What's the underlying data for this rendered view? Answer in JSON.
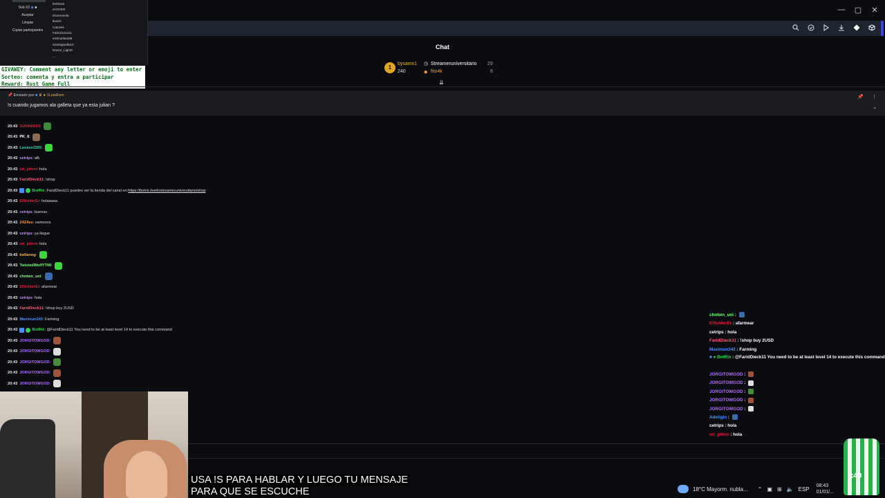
{
  "window": {
    "minimize": "—",
    "maximize": "▢",
    "close": "✕"
  },
  "toolbar_icons": [
    "search-icon",
    "shield-icon",
    "play-icon",
    "download-icon",
    "diamond-icon",
    "cube-icon"
  ],
  "control_panel": {
    "sub_label": "Sub X2",
    "accept": "Aceptar",
    "clear": "Limpiar",
    "copy": "Copiar participantes",
    "participants": [
      "bmbew2",
      "erc0r300",
      "elcomenela",
      "tlautr2",
      "Catozes",
      "Fabrizio11111",
      "emilcarlaso89",
      "Santiagoalfa10",
      "Doctor_LightX",
      "..."
    ]
  },
  "giveaway": {
    "line1": "GIVAWEY: Comment any letter or emoji to enter",
    "line2": "Sorteo: comenta y entra a participar",
    "line3": "Reward: Rust Game Full"
  },
  "chat_header": {
    "title": "Chat",
    "leader_rank": "1",
    "leader1_name": "bysamx1",
    "leader1_points": "240",
    "leader2_name": "Streameruniversitario",
    "leader2_points": "29",
    "leader3_name": "fito4k",
    "leader3_points": "8"
  },
  "pinned": {
    "sent_by": "Enviado por",
    "user": "1LuisRem",
    "message": "!s cuando jugamos ala galleta que ya esta julian ?"
  },
  "messages": [
    {
      "time": "20:43",
      "user": "GIANNIS93",
      "color": "#e0203b",
      "text": "",
      "emote": "#3f8a3a"
    },
    {
      "time": "20:43",
      "user": "PK_6",
      "color": "#ffffff",
      "text": "",
      "emote": "#8a6a52"
    },
    {
      "time": "20:43",
      "user": "Lucass1555",
      "color": "#3fd4b6",
      "text": "",
      "emote": "#3ed63e"
    },
    {
      "time": "20:43",
      "user": "cetrips",
      "color": "#c58bff",
      "text": "afk",
      "emote": ""
    },
    {
      "time": "20:43",
      "user": "uri_pitom",
      "color": "#e0203b",
      "text": "hola",
      "emote": ""
    },
    {
      "time": "20:43",
      "user": "FaridDieck11",
      "color": "#ff5c7a",
      "text": "!shop",
      "emote": ""
    },
    {
      "time": "20:43",
      "user": "BotRix",
      "color": "#35d05a",
      "text": "FaridDieck11 puedes ver la tienda del canal en: ",
      "link": "https://botrix.live/k/streameruniversitario/shop",
      "emote": ""
    },
    {
      "time": "20:43",
      "user": "ElSolderEr",
      "color": "#e0203b",
      "text": "holaaaaa",
      "emote": ""
    },
    {
      "time": "20:43",
      "user": "cetrips",
      "color": "#c58bff",
      "text": "buenas",
      "emote": ""
    },
    {
      "time": "20:43",
      "user": "Z4Z4ss",
      "color": "#ff9a3c",
      "text": "vamooos",
      "emote": ""
    },
    {
      "time": "20:43",
      "user": "cetrips",
      "color": "#c58bff",
      "text": "ya llegue",
      "emote": ""
    },
    {
      "time": "20:43",
      "user": "uri_pitom",
      "color": "#e0203b",
      "text": "hola",
      "emote": ""
    },
    {
      "time": "20:43",
      "user": "bollanog",
      "color": "#ffb347",
      "text": "",
      "emote": "#3ed63e"
    },
    {
      "time": "20:43",
      "user": "TwistedWolfYT00",
      "color": "#7dff7d",
      "text": "",
      "emote": "#3ed63e"
    },
    {
      "time": "20:43",
      "user": "chntwn_uni",
      "color": "#7dff7d",
      "text": "",
      "emote": "#3a6bb0"
    },
    {
      "time": "20:43",
      "user": "ElSolderEr",
      "color": "#e0203b",
      "text": "afarmear",
      "emote": ""
    },
    {
      "time": "20:43",
      "user": "cetrips",
      "color": "#c58bff",
      "text": "hola",
      "emote": ""
    },
    {
      "time": "20:43",
      "user": "FaridDieck11",
      "color": "#ff5c7a",
      "text": "!shop buy 2USD",
      "emote": ""
    },
    {
      "time": "20:43",
      "user": "Maximun342",
      "color": "#4f8dff",
      "text": "Farming",
      "emote": ""
    },
    {
      "time": "20:43",
      "user": "BotRix",
      "color": "#35d05a",
      "text": "@FaridDieck11 You need to be at least level 14 to execute this command",
      "emote": ""
    },
    {
      "time": "20:43",
      "user": "JORGITOWGOD",
      "color": "#b46bff",
      "text": "",
      "emote": "#a0523b"
    },
    {
      "time": "20:43",
      "user": "JORGITOWGOD",
      "color": "#b46bff",
      "text": "",
      "emote": "#dddddd"
    },
    {
      "time": "20:43",
      "user": "JORGITOWGOD",
      "color": "#b46bff",
      "text": "",
      "emote": "#4a8a3a"
    },
    {
      "time": "20:43",
      "user": "JORGITOWGOD",
      "color": "#b46bff",
      "text": "",
      "emote": "#a0523b"
    },
    {
      "time": "20:43",
      "user": "JORGITOWGOD",
      "color": "#b46bff",
      "text": "",
      "emote": "#dddddd"
    }
  ],
  "overlay": [
    {
      "user": "chntwn_uni",
      "color": "#7dff7d",
      "text": "",
      "emote": "#3a6bb0"
    },
    {
      "user": "ElSolderEr",
      "color": "#e0203b",
      "text": "afarmear",
      "emote": ""
    },
    {
      "user": "cetrips",
      "color": "#ffffff",
      "text": "hola",
      "emote": ""
    },
    {
      "user": "FaridDieck11",
      "color": "#ff5c7a",
      "text": "!shop buy 2USD",
      "emote": ""
    },
    {
      "user": "Maximun342",
      "color": "#4f8dff",
      "text": "Farming",
      "emote": ""
    },
    {
      "user": "BotRix",
      "color": "#35d05a",
      "text": "@FaridDieck11 You need to be at least level 14 to execute this command",
      "emote": "",
      "wrap": true
    },
    {
      "user": "JORGITOWGOD",
      "color": "#b46bff",
      "text": "",
      "emote": "#a0523b"
    },
    {
      "user": "JORGITOWGOD",
      "color": "#b46bff",
      "text": "",
      "emote": "#dddddd"
    },
    {
      "user": "JORGITOWGOD",
      "color": "#b46bff",
      "text": "",
      "emote": "#4a8a3a"
    },
    {
      "user": "JORGITOWGOD",
      "color": "#b46bff",
      "text": "",
      "emote": "#a0523b"
    },
    {
      "user": "JORGITOWGOD",
      "color": "#b46bff",
      "text": "",
      "emote": "#dddddd"
    },
    {
      "user": "Adetigio",
      "color": "#4f8dff",
      "text": "",
      "emote": "#3a6bb0"
    },
    {
      "user": "cetrips",
      "color": "#ffffff",
      "text": "hola",
      "emote": ""
    },
    {
      "user": "uri_pitom",
      "color": "#e0203b",
      "text": "hola",
      "emote": ""
    }
  ],
  "subtitle": {
    "line1": "USA !S PARA HABLAR Y LUEGO TU MENSAJE",
    "line2": "PARA QUE SE ESCUCHE"
  },
  "popcorn_label": "x49",
  "tray": {
    "weather": "18°C  Mayorm. nubla...",
    "lang": "ESP",
    "time": "08:43",
    "date": "01/01/..."
  }
}
